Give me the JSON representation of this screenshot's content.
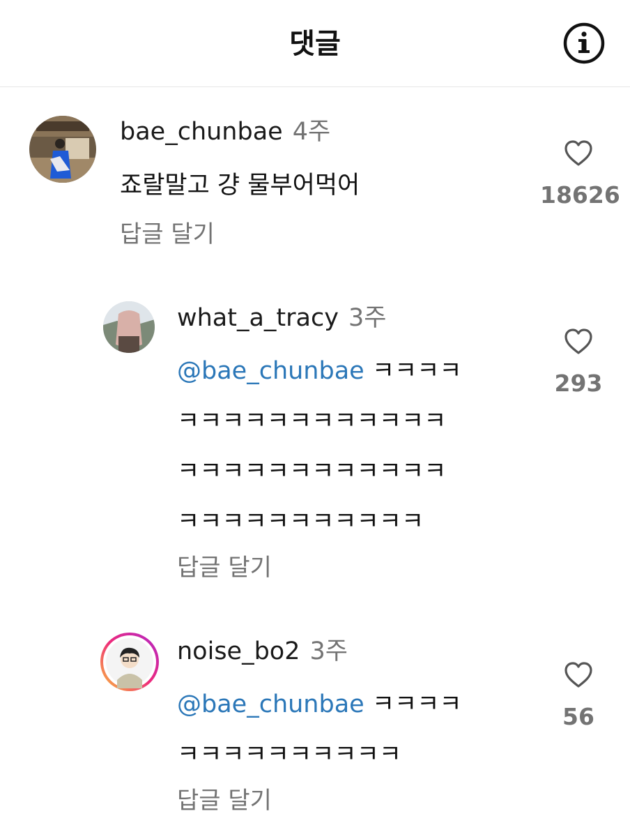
{
  "header": {
    "title": "댓글",
    "info_icon": "info-icon"
  },
  "comments": [
    {
      "username": "bae_chunbae",
      "time": "4주",
      "mention": "",
      "text": "죠랄말고 걍 물부어먹어",
      "reply_label": "답글 달기",
      "likes": "18626",
      "like_icon": "heart-outline-icon"
    },
    {
      "username": "what_a_tracy",
      "time": "3주",
      "mention": "@bae_chunbae",
      "text": "ㅋㅋㅋㅋ\nㅋㅋㅋㅋㅋㅋㅋㅋㅋㅋㅋㅋ\nㅋㅋㅋㅋㅋㅋㅋㅋㅋㅋㅋㅋ\nㅋㅋㅋㅋㅋㅋㅋㅋㅋㅋㅋ",
      "reply_label": "답글 달기",
      "likes": "293",
      "like_icon": "heart-outline-icon"
    },
    {
      "username": "noise_bo2",
      "time": "3주",
      "mention": "@bae_chunbae",
      "text": "ㅋㅋㅋㅋ\nㅋㅋㅋㅋㅋㅋㅋㅋㅋㅋ",
      "reply_label": "답글 달기",
      "likes": "56",
      "like_icon": "heart-outline-icon"
    }
  ]
}
